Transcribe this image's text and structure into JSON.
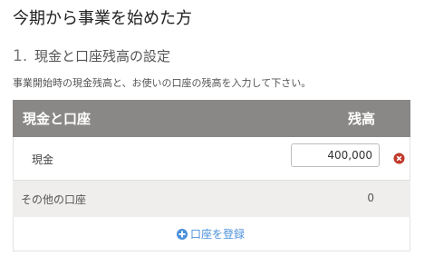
{
  "page": {
    "title": "今期から事業を始めた方"
  },
  "section": {
    "number": "1.",
    "title": "現金と口座残高の設定",
    "description": "事業開始時の現金残高と、お使いの口座の残高を入力して下さい。"
  },
  "table": {
    "headers": {
      "account": "現金と口座",
      "balance": "残高"
    },
    "rows": {
      "cash": {
        "label": "現金",
        "value": "400,000"
      },
      "other": {
        "label": "その他の口座",
        "value": "0"
      }
    },
    "add_account_label": "口座を登録"
  },
  "colors": {
    "header_bg": "#8a8886",
    "other_row_bg": "#efeeed",
    "link": "#4a90d9",
    "remove": "#c0392b"
  },
  "icons": {
    "remove": "remove-circle-icon",
    "add": "plus-circle-icon"
  }
}
